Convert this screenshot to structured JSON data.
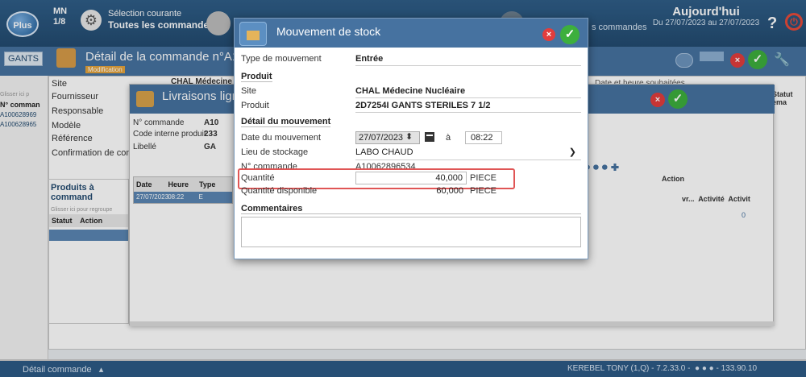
{
  "topbar": {
    "logo": "Plus",
    "mn": "MN",
    "page": "1/8",
    "selection_label": "Sélection courante",
    "selection_value": "Toutes les commandes",
    "commands_text": "s commandes",
    "today": "Aujourd'hui",
    "range": "Du 27/07/2023 au 27/07/2023",
    "help": "?"
  },
  "subbar": {
    "gants": "GANTS",
    "detail_title": "Détail de la commande n°A1006",
    "badge": "Modification"
  },
  "left_col": {
    "hint": "Glisser ici p",
    "header": "N° comman",
    "rows": [
      "A100628969",
      "A100628965"
    ]
  },
  "bg_form": {
    "site": "Site",
    "fournisseur": "Fournisseur",
    "responsable": "Responsable",
    "modele": "Modèle",
    "reference": "Référence",
    "confirmation": "Confirmation de com",
    "site_value": "CHAL Médecine N",
    "date_souhaitee": "Date et heure souhaitées",
    "statut_header": "Statut ema"
  },
  "livraisons": {
    "title": "Livraisons ligne A",
    "labels": [
      "N° commande",
      "Code interne produit",
      "Libellé"
    ],
    "values": [
      "A10",
      "233",
      "GA"
    ],
    "table_headers": [
      "Date",
      "Heure",
      "Type"
    ],
    "row": [
      "27/07/2023",
      "08:22",
      "E"
    ],
    "action_header": "Action"
  },
  "products": {
    "title": "Produits à command",
    "hint": "Glisser ici pour regroupe",
    "headers": [
      "Statut",
      "Action"
    ]
  },
  "right_cols": {
    "headers": [
      "vr...",
      "Activité",
      "Activit"
    ],
    "zero": "0"
  },
  "modal": {
    "title": "Mouvement de stock",
    "type_label": "Type de mouvement",
    "type_value": "Entrée",
    "section_product": "Produit",
    "site_label": "Site",
    "site_value": "CHAL Médecine Nucléaire",
    "product_label": "Produit",
    "product_value": "2D7254I GANTS STERILES 7 1/2",
    "section_detail": "Détail du mouvement",
    "date_label": "Date du mouvement",
    "date_value": "27/07/2023",
    "a_label": "à",
    "time_value": "08:22",
    "location_label": "Lieu de stockage",
    "location_value": "LABO CHAUD",
    "order_label": "N° commande",
    "order_value": "A10062896534",
    "qty_label": "Quantité",
    "qty_value": "40,000",
    "qty_unit": "PIECE",
    "qty_avail_label": "Quantité disponible",
    "qty_avail_value": "60,000",
    "qty_avail_unit": "PIECE",
    "comments_label": "Commentaires"
  },
  "bottombar": {
    "left": "Détail commande",
    "user": "KEREBEL TONY (1,Q) - 7.2.33.0 -",
    "ip": "- 133.90.10"
  },
  "colors": {
    "header_blue": "#4672a0",
    "accent_red": "#e05555",
    "ok_green": "#3daf3d"
  }
}
